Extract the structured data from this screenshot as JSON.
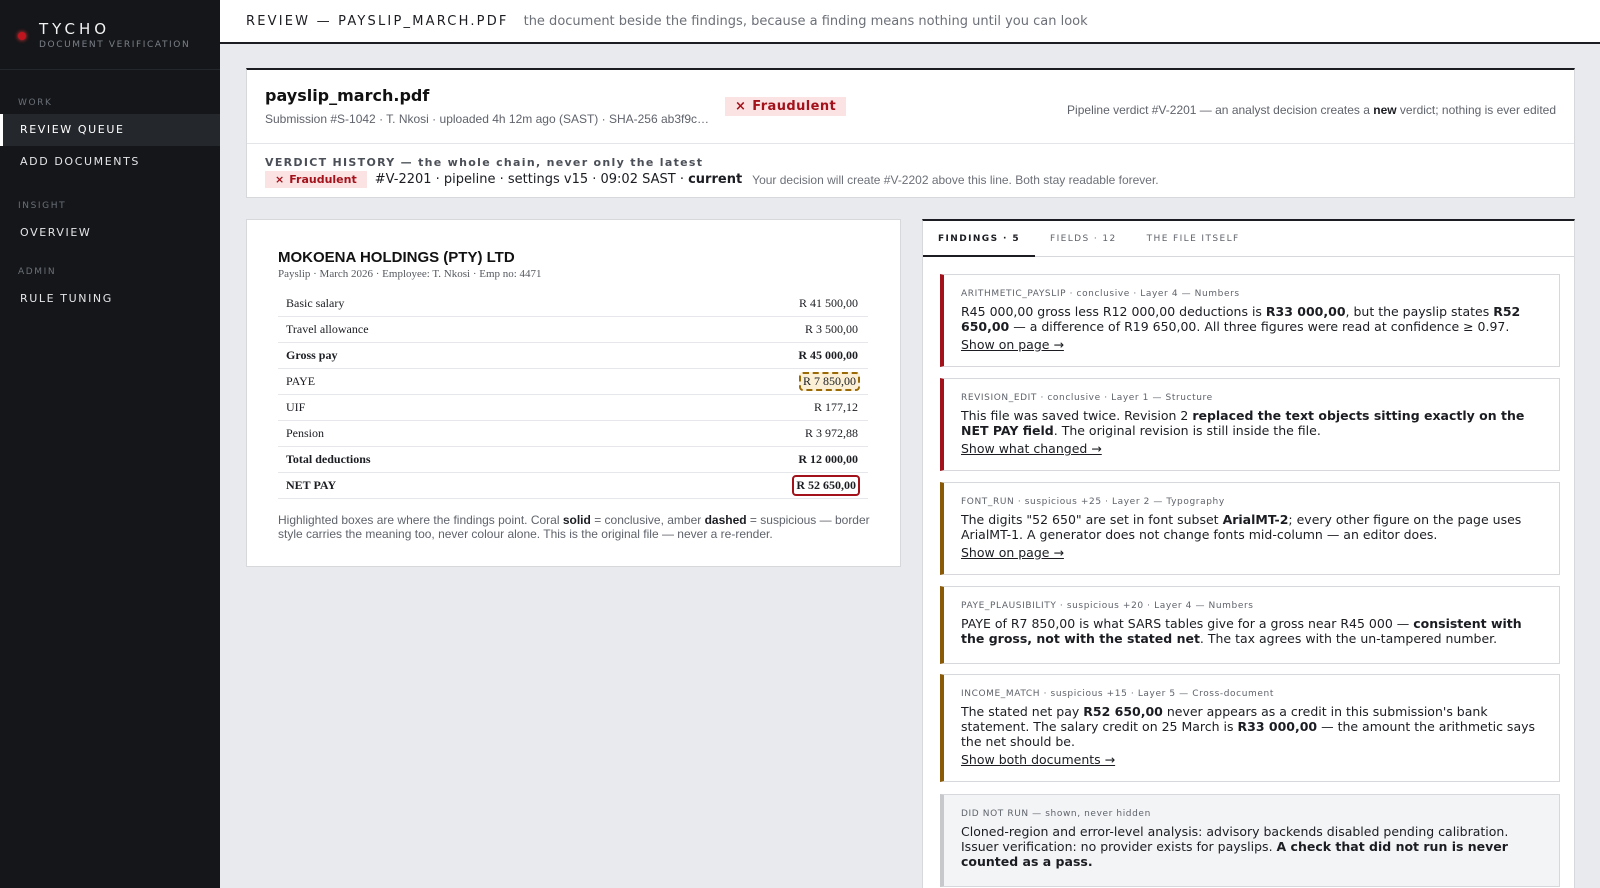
{
  "sidebar": {
    "brand": "TYCHO",
    "brand_sub": "DOCUMENT VERIFICATION",
    "sections": {
      "work": "WORK",
      "insight": "INSIGHT",
      "admin": "ADMIN"
    },
    "items": {
      "review_queue": "REVIEW QUEUE",
      "add_documents": "ADD DOCUMENTS",
      "overview": "OVERVIEW",
      "rule_tuning": "RULE TUNING"
    }
  },
  "header": {
    "title": "REVIEW — PAYSLIP_MARCH.PDF",
    "subtitle": "the document beside the findings, because a finding means nothing until you can look"
  },
  "submission": {
    "filename": "payslip_march.pdf",
    "meta": "Submission #S-1042 · T. Nkosi · uploaded 4h 12m ago (SAST) · SHA-256 ab3f9c…",
    "verdict_icon": "×",
    "verdict": "Fraudulent",
    "pipeline_note_prefix": "Pipeline verdict #V-2201 — an analyst decision creates a ",
    "pipeline_note_bold": "new",
    "pipeline_note_suffix": " verdict; nothing is ever edited"
  },
  "history": {
    "title": "VERDICT HISTORY — the whole chain, never only the latest",
    "badge_icon": "×",
    "badge": "Fraudulent",
    "entry": "#V-2201 · pipeline · settings v15 · 09:02 SAST · ",
    "entry_current": "current",
    "note": "Your decision will create #V-2202 above this line. Both stay readable forever."
  },
  "document": {
    "company": "MOKOENA HOLDINGS (PTY) LTD",
    "subtitle": "Payslip · March 2026 · Employee: T. Nkosi · Emp no: 4471",
    "rows": [
      {
        "label": "Basic salary",
        "value": "R 41 500,00",
        "bold": false,
        "highlight": ""
      },
      {
        "label": "Travel allowance",
        "value": "R 3 500,00",
        "bold": false,
        "highlight": ""
      },
      {
        "label": "Gross pay",
        "value": "R 45 000,00",
        "bold": true,
        "highlight": ""
      },
      {
        "label": "PAYE",
        "value": "R 7 850,00",
        "bold": false,
        "highlight": "suspicious"
      },
      {
        "label": "UIF",
        "value": "R 177,12",
        "bold": false,
        "highlight": ""
      },
      {
        "label": "Pension",
        "value": "R 3 972,88",
        "bold": false,
        "highlight": ""
      },
      {
        "label": "Total deductions",
        "value": "R 12 000,00",
        "bold": true,
        "highlight": ""
      },
      {
        "label": "NET PAY",
        "value": "R 52 650,00",
        "bold": true,
        "highlight": "conclusive"
      }
    ],
    "caption": {
      "p1": "Highlighted boxes are where the findings point. Coral ",
      "b1": "solid",
      "p2": " = conclusive, amber ",
      "b2": "dashed",
      "p3": " = suspicious — border style carries the meaning too, never colour alone. This is the original file — never a re-render."
    }
  },
  "tabs": {
    "findings": "FINDINGS · 5",
    "fields": "FIELDS · 12",
    "file": "THE FILE ITSELF"
  },
  "findings": [
    {
      "meta": "ARITHMETIC_PAYSLIP · conclusive · Layer 4 — Numbers",
      "p1": "R45 000,00 gross less R12 000,00 deductions is ",
      "b1": "R33 000,00",
      "p2": ", but the payslip states ",
      "b2": "R52 650,00",
      "p3": " — a difference of R19 650,00. All three figures were read at confidence ≥ 0.97.",
      "link": "Show on page →"
    },
    {
      "meta": "REVISION_EDIT · conclusive · Layer 1 — Structure",
      "p1": "This file was saved twice. Revision 2 ",
      "b1": "replaced the text objects sitting exactly on the NET PAY field",
      "p2": ". The original revision is still inside the file.",
      "link": "Show what changed →"
    },
    {
      "meta": "FONT_RUN · suspicious +25 · Layer 2 — Typography",
      "p1": "The digits \"52 650\" are set in font subset ",
      "b1": "ArialMT-2",
      "p2": "; every other figure on the page uses ArialMT-1. A generator does not change fonts mid-column — an editor does.",
      "link": "Show on page →"
    },
    {
      "meta": "PAYE_PLAUSIBILITY · suspicious +20 · Layer 4 — Numbers",
      "p1": "PAYE of R7 850,00 is what SARS tables give for a gross near R45 000 — ",
      "b1": "consistent with the gross, not with the stated net",
      "p2": ". The tax agrees with the un-tampered number."
    },
    {
      "meta": "INCOME_MATCH · suspicious +15 · Layer 5 — Cross-document",
      "p1": "The stated net pay ",
      "b1": "R52 650,00",
      "p2": " never appears as a credit in this submission's bank statement. The salary credit on 25 March is ",
      "b2": "R33 000,00",
      "p3": " — the amount the arithmetic says the net should be.",
      "link": "Show both documents →"
    },
    {
      "meta": "DID NOT RUN — shown, never hidden",
      "p1": "Cloned-region and error-level analysis: advisory backends disabled pending calibration. Issuer verification: no provider exists for payslips. ",
      "b1": "A check that did not run is never counted as a pass."
    }
  ],
  "colors": {
    "sidebar_bg": "#141619",
    "conclusive": "#a3121b",
    "suspicious": "#8a5a06",
    "badge_bg": "#fbe3e4"
  }
}
